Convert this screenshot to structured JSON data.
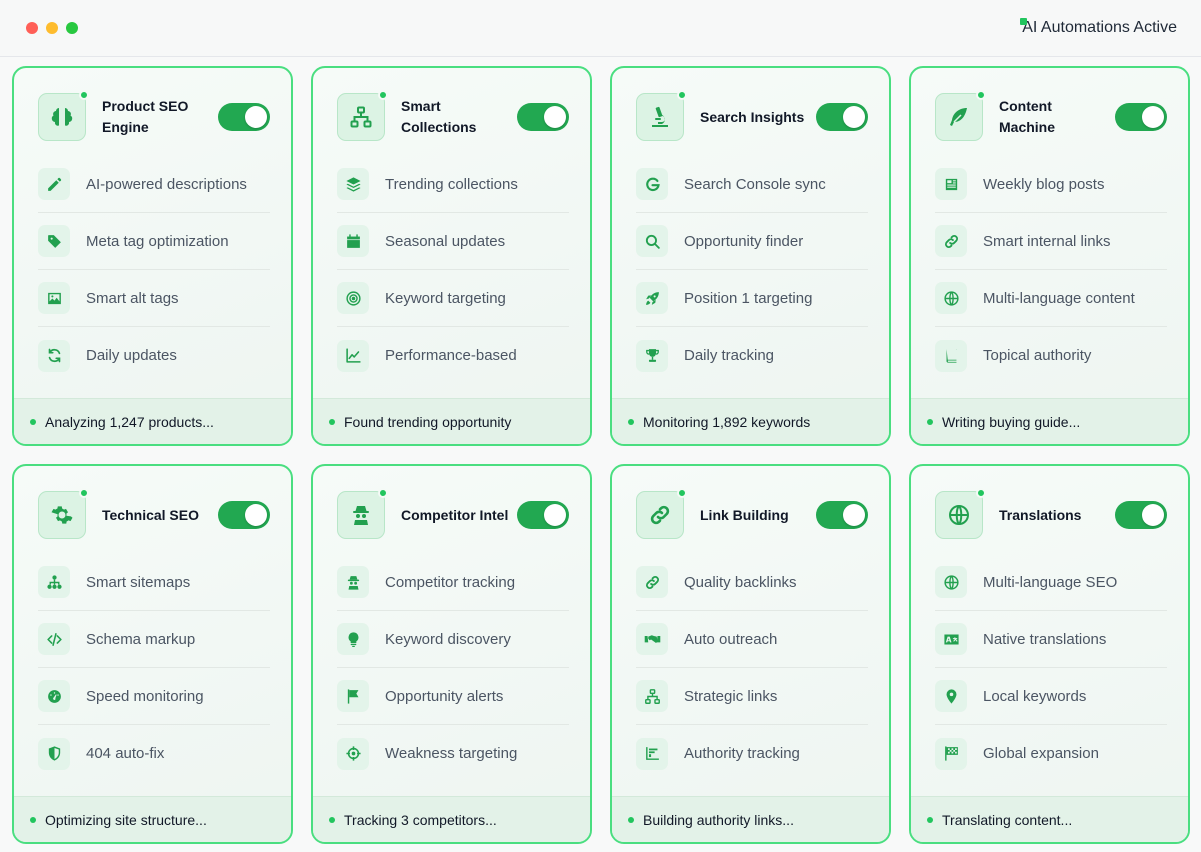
{
  "header": {
    "status_text": "AI Automations Active"
  },
  "colors": {
    "accent": "#22a851",
    "icon": "#22a04f",
    "border": "#4ade80"
  },
  "cards": [
    {
      "id": "product-seo",
      "title": "Product SEO Engine",
      "icon": "brain-icon",
      "enabled": true,
      "features": [
        {
          "label": "AI-powered descriptions",
          "icon": "pencil-icon"
        },
        {
          "label": "Meta tag optimization",
          "icon": "tag-icon"
        },
        {
          "label": "Smart alt tags",
          "icon": "image-icon"
        },
        {
          "label": "Daily updates",
          "icon": "refresh-icon"
        }
      ],
      "status": "Analyzing 1,247 products..."
    },
    {
      "id": "smart-collections",
      "title": "Smart Collections",
      "icon": "sitemap-icon",
      "enabled": true,
      "features": [
        {
          "label": "Trending collections",
          "icon": "layers-icon"
        },
        {
          "label": "Seasonal updates",
          "icon": "calendar-icon"
        },
        {
          "label": "Keyword targeting",
          "icon": "target-icon"
        },
        {
          "label": "Performance-based",
          "icon": "chart-line-icon"
        }
      ],
      "status": "Found trending opportunity"
    },
    {
      "id": "search-insights",
      "title": "Search Insights",
      "icon": "microscope-icon",
      "enabled": true,
      "features": [
        {
          "label": "Search Console sync",
          "icon": "google-icon"
        },
        {
          "label": "Opportunity finder",
          "icon": "search-icon"
        },
        {
          "label": "Position 1 targeting",
          "icon": "rocket-icon"
        },
        {
          "label": "Daily tracking",
          "icon": "trophy-icon"
        }
      ],
      "status": "Monitoring 1,892 keywords"
    },
    {
      "id": "content-machine",
      "title": "Content Machine",
      "icon": "feather-icon",
      "enabled": true,
      "features": [
        {
          "label": "Weekly blog posts",
          "icon": "newspaper-icon"
        },
        {
          "label": "Smart internal links",
          "icon": "link-icon"
        },
        {
          "label": "Multi-language content",
          "icon": "globe-icon"
        },
        {
          "label": "Topical authority",
          "icon": "book-icon"
        }
      ],
      "status": "Writing buying guide..."
    },
    {
      "id": "technical-seo",
      "title": "Technical SEO",
      "icon": "gear-icon",
      "enabled": true,
      "features": [
        {
          "label": "Smart sitemaps",
          "icon": "hierarchy-icon"
        },
        {
          "label": "Schema markup",
          "icon": "code-icon"
        },
        {
          "label": "Speed monitoring",
          "icon": "gauge-icon"
        },
        {
          "label": "404 auto-fix",
          "icon": "shield-icon"
        }
      ],
      "status": "Optimizing site structure..."
    },
    {
      "id": "competitor-intel",
      "title": "Competitor Intel",
      "icon": "spy-icon",
      "enabled": true,
      "features": [
        {
          "label": "Competitor tracking",
          "icon": "spy-icon"
        },
        {
          "label": "Keyword discovery",
          "icon": "lightbulb-icon"
        },
        {
          "label": "Opportunity alerts",
          "icon": "flag-icon"
        },
        {
          "label": "Weakness targeting",
          "icon": "crosshairs-icon"
        }
      ],
      "status": "Tracking 3 competitors..."
    },
    {
      "id": "link-building",
      "title": "Link Building",
      "icon": "link-icon",
      "enabled": true,
      "features": [
        {
          "label": "Quality backlinks",
          "icon": "link-icon"
        },
        {
          "label": "Auto outreach",
          "icon": "handshake-icon"
        },
        {
          "label": "Strategic links",
          "icon": "sitemap-icon"
        },
        {
          "label": "Authority tracking",
          "icon": "bar-chart-icon"
        }
      ],
      "status": "Building authority links..."
    },
    {
      "id": "translations",
      "title": "Translations",
      "icon": "globe-icon",
      "enabled": true,
      "features": [
        {
          "label": "Multi-language SEO",
          "icon": "globe-icon"
        },
        {
          "label": "Native translations",
          "icon": "language-icon"
        },
        {
          "label": "Local keywords",
          "icon": "map-pin-icon"
        },
        {
          "label": "Global expansion",
          "icon": "checkered-flag-icon"
        }
      ],
      "status": "Translating content..."
    }
  ]
}
